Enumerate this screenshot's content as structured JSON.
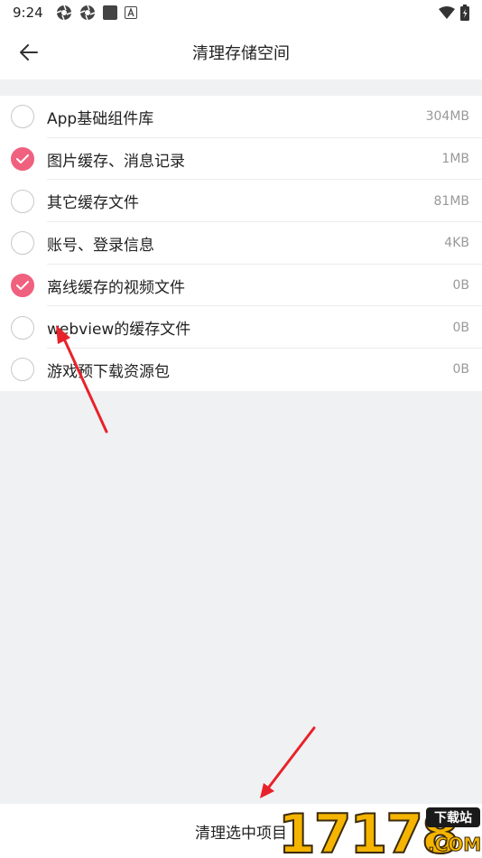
{
  "status_bar": {
    "time": "9:24",
    "icons_left": [
      "aperture-icon",
      "aperture-icon",
      "square-icon",
      "a-badge-icon"
    ],
    "icons_right": [
      "wifi-icon",
      "battery-icon"
    ]
  },
  "header": {
    "title": "清理存储空间",
    "back_icon": "back-arrow-icon"
  },
  "items": [
    {
      "label": "App基础组件库",
      "size": "304MB",
      "checked": false
    },
    {
      "label": "图片缓存、消息记录",
      "size": "1MB",
      "checked": true
    },
    {
      "label": "其它缓存文件",
      "size": "81MB",
      "checked": false
    },
    {
      "label": "账号、登录信息",
      "size": "4KB",
      "checked": false
    },
    {
      "label": "离线缓存的视频文件",
      "size": "0B",
      "checked": true
    },
    {
      "label": "webview的缓存文件",
      "size": "0B",
      "checked": false
    },
    {
      "label": "游戏预下载资源包",
      "size": "0B",
      "checked": false
    }
  ],
  "bottom_button": {
    "label": "清理选中项目"
  },
  "watermark": {
    "number": "17178",
    "badge": "下载站",
    "domain": ".COM"
  },
  "colors": {
    "accent": "#f0607f",
    "annotation": "#e8222a",
    "background": "#f0f1f3"
  }
}
